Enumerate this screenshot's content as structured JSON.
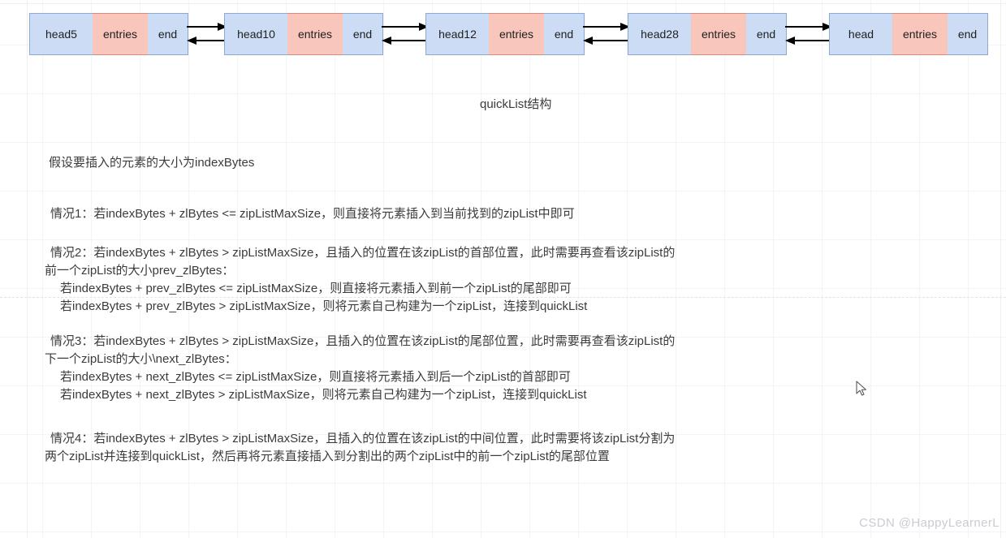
{
  "diagram": {
    "title": "quickList结构",
    "nodes": [
      {
        "head_label": "head",
        "head_value": "5",
        "entries_label": "entries",
        "end_label": "end"
      },
      {
        "head_label": "head",
        "head_value": "10",
        "entries_label": "entries",
        "end_label": "end"
      },
      {
        "head_label": "head",
        "head_value": "12",
        "entries_label": "entries",
        "end_label": "end"
      },
      {
        "head_label": "head",
        "head_value": "28",
        "entries_label": "entries",
        "end_label": "end"
      },
      {
        "head_label": "head",
        "head_value": "",
        "entries_label": "entries",
        "end_label": "end"
      }
    ],
    "colors": {
      "head_fill": "#ccdcf4",
      "head_stroke": "#8ea9d4",
      "entries_fill": "#f8c6bb",
      "entries_stroke": "#d98b7c",
      "arrow": "#000000",
      "grid": "#f2f4f7"
    }
  },
  "notes": {
    "assumption": "假设要插入的元素的大小为indexBytes",
    "case1": "情况1：若indexBytes + zlBytes <= zipListMaxSize，则直接将元素插入到当前找到的zipList中即可",
    "case2_line1": "情况2：若indexBytes + zlBytes > zipListMaxSize，且插入的位置在该zipList的首部位置，此时需要再查看该zipList的",
    "case2_line2": "前一个zipList的大小prev_zlBytes：",
    "case2_line3": "若indexBytes + prev_zlBytes <= zipListMaxSize，则直接将元素插入到前一个zipList的尾部即可",
    "case2_line4": "若indexBytes + prev_zlBytes > zipListMaxSize，则将元素自己构建为一个zipList，连接到quickList",
    "case3_line1": "情况3：若indexBytes + zlBytes > zipListMaxSize，且插入的位置在该zipList的尾部位置，此时需要再查看该zipList的",
    "case3_line2": "下一个zipList的大小\\next_zlBytes：",
    "case3_line3": "若indexBytes + next_zlBytes <= zipListMaxSize，则直接将元素插入到后一个zipList的首部即可",
    "case3_line4": "若indexBytes + next_zlBytes > zipListMaxSize，则将元素自己构建为一个zipList，连接到quickList",
    "case4_line1": "情况4：若indexBytes + zlBytes > zipListMaxSize，且插入的位置在该zipList的中间位置，此时需要将该zipList分割为",
    "case4_line2": "两个zipList并连接到quickList，然后再将元素直接插入到分割出的两个zipList中的前一个zipList的尾部位置"
  },
  "watermark": "CSDN @HappyLearnerL"
}
